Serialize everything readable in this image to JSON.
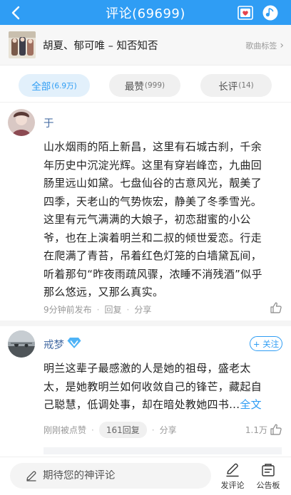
{
  "header": {
    "title": "评论(69699)",
    "back_icon": "chevron-left-icon",
    "fav_icon": "favorite-card-icon",
    "music_icon": "music-note-icon",
    "accent": "#2f9df4"
  },
  "song": {
    "title": "胡夏、郁可唯 – 知否知否",
    "tag_label": "歌曲标签"
  },
  "tabs": [
    {
      "label": "全部",
      "count": "(6.9万)",
      "active": true
    },
    {
      "label": "最赞",
      "count": "(999)",
      "active": false
    },
    {
      "label": "长评",
      "count": "(14)",
      "active": false
    }
  ],
  "comments": [
    {
      "user": "于",
      "lines": [
        "山水烟雨的陌上新昌，这里有石城古刹，千余",
        "年历史中沉淀光辉。这里有穿岩峰峦，九曲回",
        "肠里远山如黛。七盘仙谷的古意风光，靓美了",
        "四季，天老山的气势恢宏，静美了冬季雪光。",
        "这里有元气满满的大娘子，初恋甜蜜的小公",
        "爷，也在上演着明兰和二叔的倾世爱恋。行走",
        "在爬满了青苔，吊着红色灯笼的白墙黛瓦间，",
        "听着那句“昨夜雨疏风骤，浓睡不消残酒”似乎",
        "那么悠远，又那么真实。"
      ],
      "time": "9分钟前发布",
      "reply": "回复",
      "share": "分享"
    },
    {
      "user": "戒梦",
      "follow_label": "+ 关注",
      "lines": [
        "明兰这辈子最感激的人是她的祖母，盛老太",
        "太，是她教明兰如何收敛自己的锋芒，藏起自",
        "己聪慧，低调处事，却在暗处教她四书..."
      ],
      "more_label": "全文",
      "time": "刚刚被点赞",
      "reply_count": "161回复",
      "share": "分享",
      "likes": "1.1万"
    }
  ],
  "bottom": {
    "placeholder": "期待您的神评论",
    "write_label": "发评论",
    "notice_label": "公告板"
  }
}
